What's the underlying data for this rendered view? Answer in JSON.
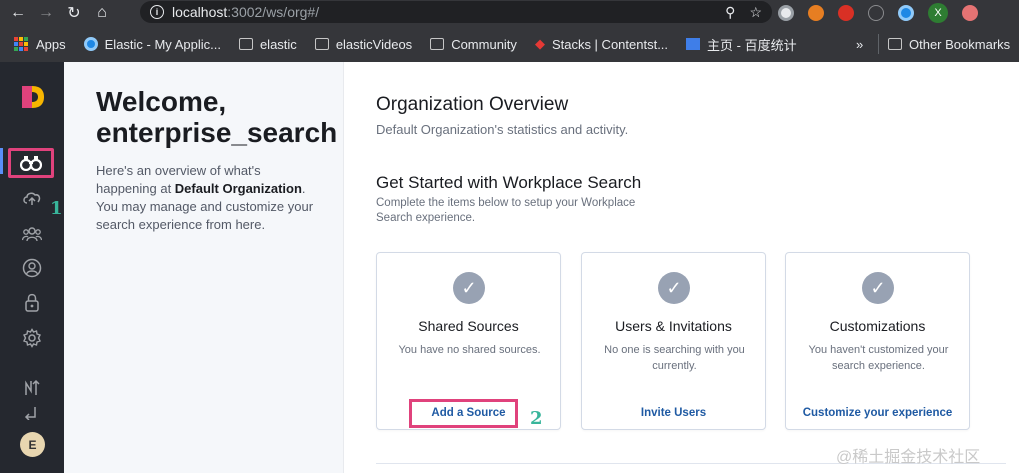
{
  "browser": {
    "back_icon": "←",
    "forward_icon": "→",
    "reload_icon": "↻",
    "home_icon": "⌂",
    "url_host": "localhost",
    "url_path": ":3002/ws/org#/",
    "zoom_icon": "⚲",
    "star_icon": "☆",
    "profile_initial": "X",
    "bookmarks": [
      {
        "label": "Apps"
      },
      {
        "label": "Elastic - My Applic..."
      },
      {
        "label": "elastic"
      },
      {
        "label": "elasticVideos"
      },
      {
        "label": "Community"
      },
      {
        "label": "Stacks | Contentst..."
      },
      {
        "label": "主页 - 百度统计"
      }
    ],
    "more_label": "»",
    "other_bookmarks": "Other Bookmarks"
  },
  "sidebar": {
    "active_icon": "binoculars-icon",
    "annotation_1": "1",
    "user_initial": "E"
  },
  "welcome": {
    "title": "Welcome, enterprise_search",
    "text_before": "Here's an overview of what's happening at ",
    "org_name": "Default Organization",
    "text_after": ". You may manage and customize your search experience from here."
  },
  "overview": {
    "title": "Organization Overview",
    "subtitle": "Default Organization's statistics and activity."
  },
  "get_started": {
    "title": "Get Started with Workplace Search",
    "subtitle": "Complete the items below to setup your Workplace Search experience."
  },
  "cards": [
    {
      "title": "Shared Sources",
      "desc": "You have no shared sources.",
      "link": "Add a Source"
    },
    {
      "title": "Users & Invitations",
      "desc": "No one is searching with you currently.",
      "link": "Invite Users"
    },
    {
      "title": "Customizations",
      "desc": "You haven't customized your search experience.",
      "link": "Customize your experience"
    }
  ],
  "annotation_2": "2",
  "watermark": "@稀土掘金技术社区",
  "colors": {
    "sidebar_bg": "#25282f",
    "highlight": "#e0427c",
    "link": "#1f5aa3",
    "annotation": "#38b59b"
  }
}
